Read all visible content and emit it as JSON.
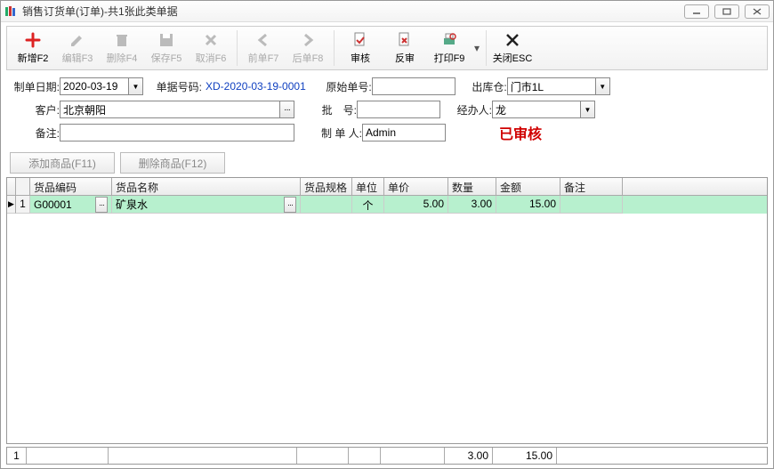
{
  "window": {
    "title": "销售订货单(订单)-共1张此类单据"
  },
  "toolbar": {
    "new": "新增F2",
    "edit": "编辑F3",
    "delete": "删除F4",
    "save": "保存F5",
    "cancel": "取消F6",
    "prev": "前单F7",
    "next": "后单F8",
    "audit": "审核",
    "unaudit": "反审",
    "print": "打印F9",
    "close": "关闭ESC"
  },
  "form": {
    "labels": {
      "date": "制单日期:",
      "docno": "单据号码:",
      "origno": "原始单号:",
      "warehouse": "出库仓:",
      "customer": "客户:",
      "batch": "批　号:",
      "operator": "经办人:",
      "remark": "备注:",
      "maker": "制 单 人:"
    },
    "date": "2020-03-19",
    "docno": "XD-2020-03-19-0001",
    "origno": "",
    "warehouse": "门市1L",
    "customer": "北京朝阳",
    "batch": "",
    "operator": "龙",
    "remark": "",
    "maker": "Admin",
    "status": "已审核"
  },
  "buttons": {
    "addItem": "添加商品(F11)",
    "delItem": "删除商品(F12)"
  },
  "grid": {
    "headers": {
      "code": "货品编码",
      "name": "货品名称",
      "spec": "货品规格",
      "unit": "单位",
      "price": "单价",
      "qty": "数量",
      "amount": "金额",
      "remark": "备注"
    },
    "rows": [
      {
        "idx": "1",
        "code": "G00001",
        "name": "矿泉水",
        "spec": "",
        "unit": "个",
        "price": "5.00",
        "qty": "3.00",
        "amount": "15.00",
        "remark": ""
      }
    ],
    "totals": {
      "idx": "1",
      "qty": "3.00",
      "amount": "15.00"
    }
  }
}
